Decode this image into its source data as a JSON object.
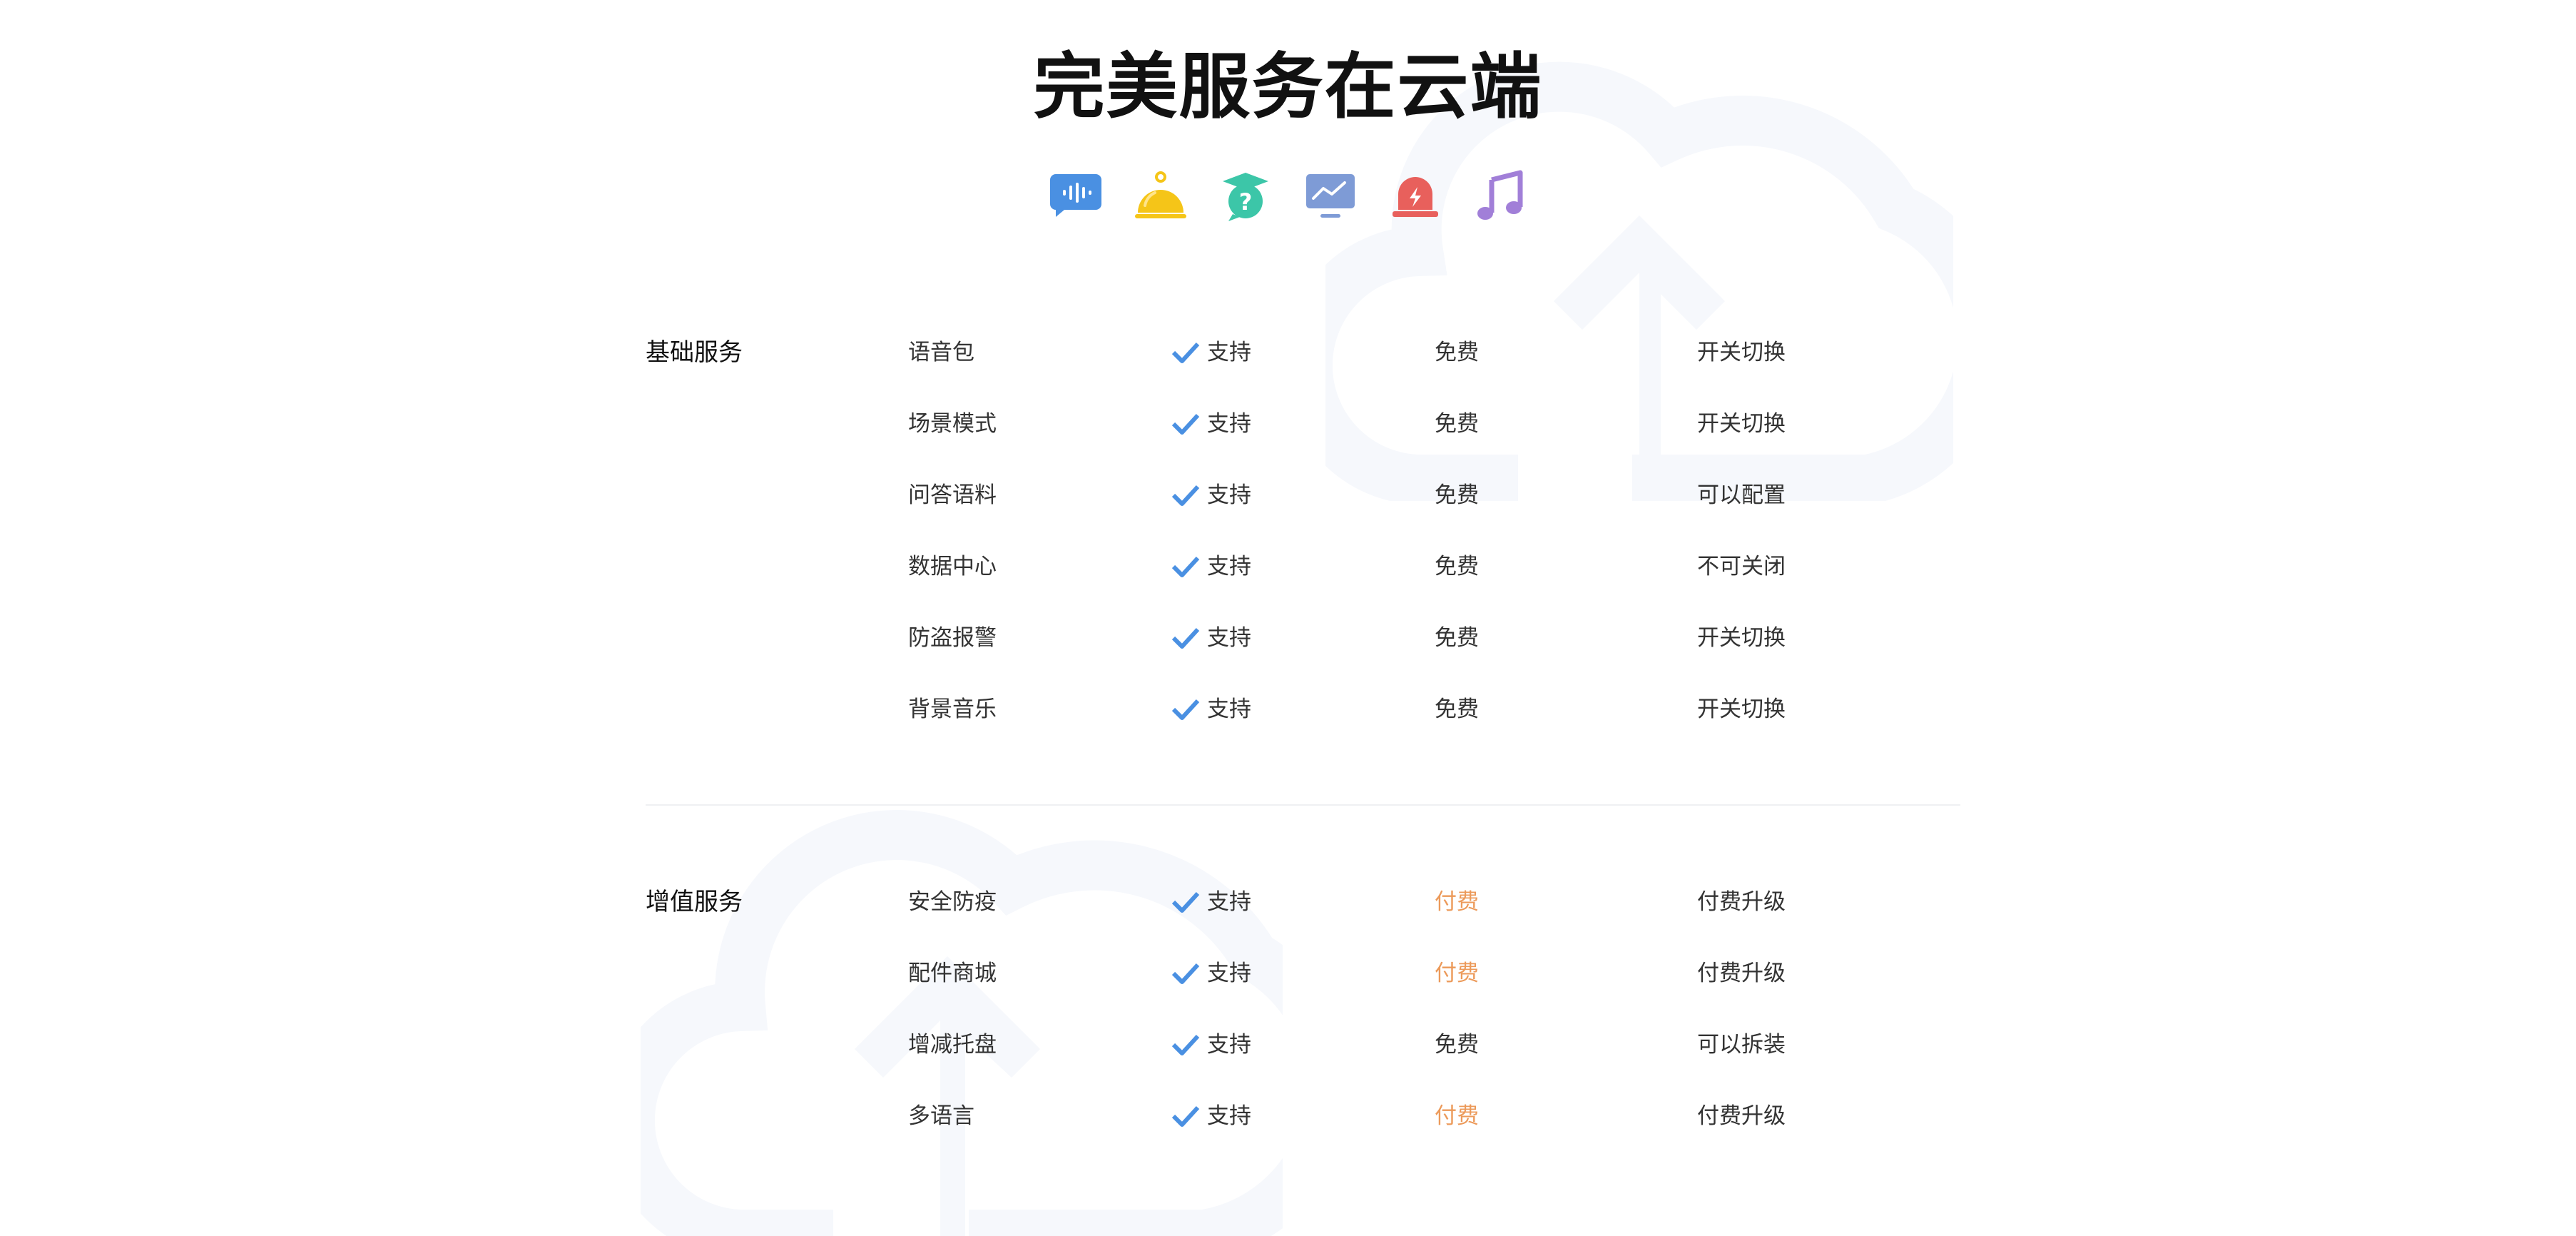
{
  "title": "完美服务在云端",
  "icons": [
    {
      "name": "voice-bubble-icon",
      "color": "#4A90E2"
    },
    {
      "name": "service-bell-icon",
      "color": "#F5C518"
    },
    {
      "name": "graduation-question-icon",
      "color": "#3CC6A8"
    },
    {
      "name": "monitor-chart-icon",
      "color": "#7E9BD6"
    },
    {
      "name": "alarm-siren-icon",
      "color": "#E8605C"
    },
    {
      "name": "music-note-icon",
      "color": "#A17FD8"
    }
  ],
  "colors": {
    "check": "#4A90E2",
    "paid": "#EC9A5A",
    "cloud_bg": "#F6F8FC"
  },
  "sections": [
    {
      "label": "基础服务",
      "rows": [
        {
          "name": "语音包",
          "support": "支持",
          "price": "免费",
          "note": "开关切换"
        },
        {
          "name": "场景模式",
          "support": "支持",
          "price": "免费",
          "note": "开关切换"
        },
        {
          "name": "问答语料",
          "support": "支持",
          "price": "免费",
          "note": "可以配置"
        },
        {
          "name": "数据中心",
          "support": "支持",
          "price": "免费",
          "note": "不可关闭"
        },
        {
          "name": "防盗报警",
          "support": "支持",
          "price": "免费",
          "note": "开关切换"
        },
        {
          "name": "背景音乐",
          "support": "支持",
          "price": "免费",
          "note": "开关切换"
        }
      ]
    },
    {
      "label": "增值服务",
      "rows": [
        {
          "name": "安全防疫",
          "support": "支持",
          "price": "付费",
          "note": "付费升级"
        },
        {
          "name": "配件商城",
          "support": "支持",
          "price": "付费",
          "note": "付费升级"
        },
        {
          "name": "增减托盘",
          "support": "支持",
          "price": "免费",
          "note": "可以拆装"
        },
        {
          "name": "多语言",
          "support": "支持",
          "price": "付费",
          "note": "付费升级"
        }
      ]
    }
  ]
}
